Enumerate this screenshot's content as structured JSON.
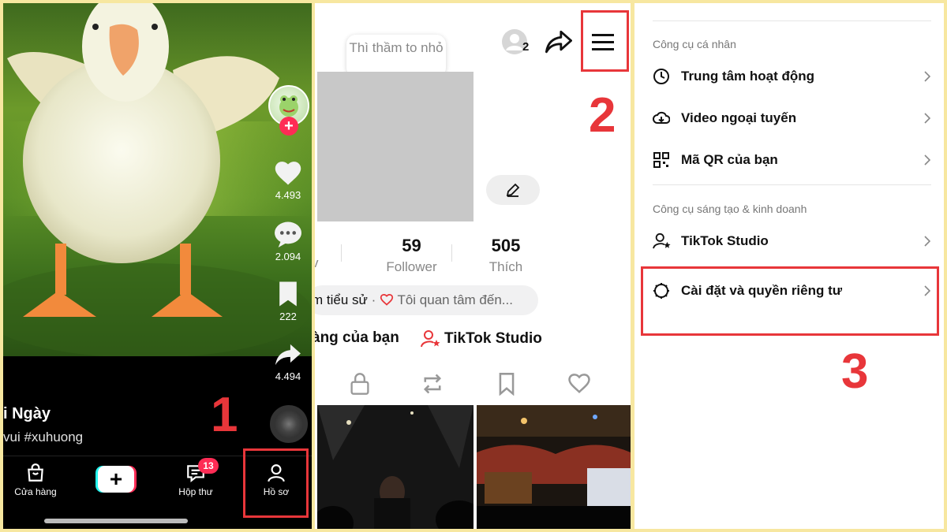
{
  "video": {
    "likes": "4.493",
    "comments": "2.094",
    "saves": "222",
    "shares": "4.494",
    "caption_title": "i Ngày",
    "caption_tags": "vui #xuhuong"
  },
  "bottom_nav": {
    "shop": "Cửa hàng",
    "inbox": "Hộp thư",
    "inbox_badge": "13",
    "profile": "Hồ sơ"
  },
  "profile": {
    "friends_count": "2",
    "tooltip": "Thì thầm to nhỏ",
    "stats": [
      {
        "value": "59",
        "label": "Follower"
      },
      {
        "value": "505",
        "label": "Thích"
      }
    ],
    "stat_fragment": "v",
    "bio_prefix": "m tiểu sử",
    "bio_sep": "·",
    "bio_interest": "Tôi quan tâm đến...",
    "shop_link": "àng của bạn",
    "studio_link": "TikTok Studio"
  },
  "menu": {
    "section_personal": "Công cụ cá nhân",
    "activity": "Trung tâm hoạt động",
    "offline": "Video ngoại tuyến",
    "qr": "Mã QR của bạn",
    "section_creator": "Công cụ sáng tạo & kinh doanh",
    "studio": "TikTok Studio",
    "settings": "Cài đặt và quyền riêng tư"
  },
  "steps": [
    "1",
    "2",
    "3"
  ],
  "colors": {
    "highlight": "#e8363a",
    "tiktok_red": "#fe2c55",
    "tiktok_cyan": "#25f4ee",
    "frame": "#f7e7a0"
  }
}
